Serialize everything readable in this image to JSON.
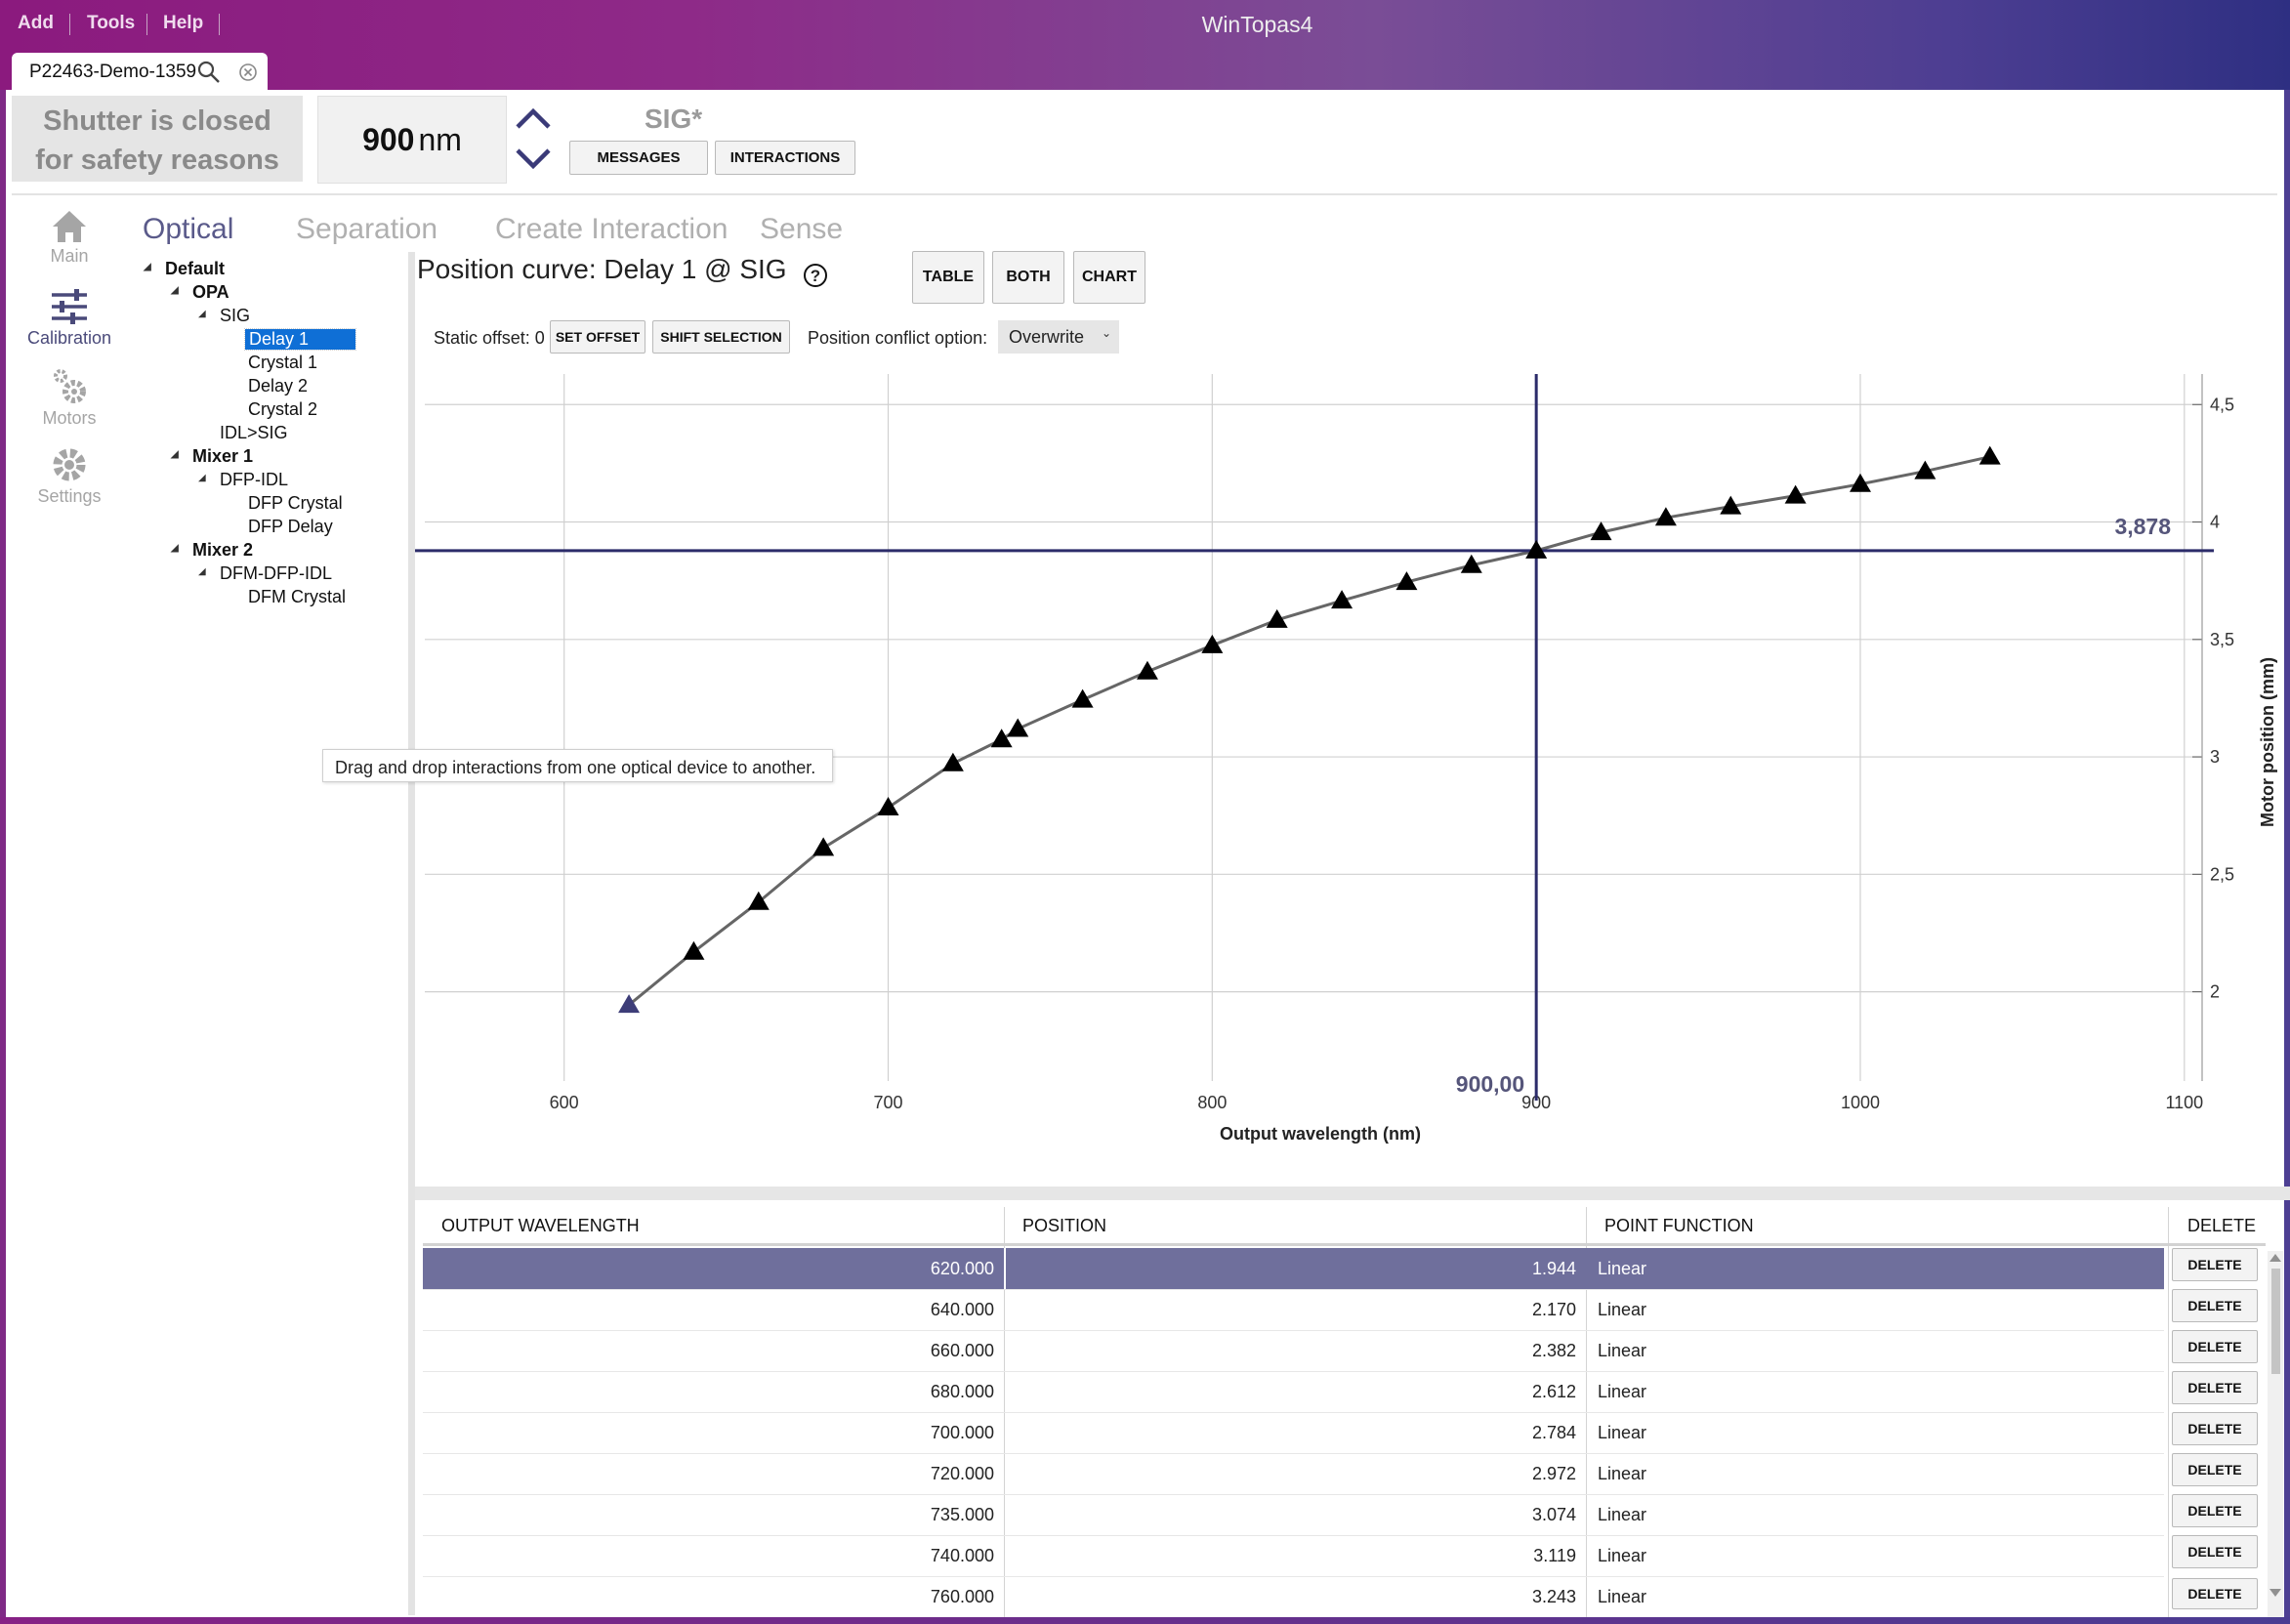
{
  "window": {
    "title": "WinTopas4",
    "menu": [
      "Add",
      "Tools",
      "Help"
    ],
    "tab_label": "P22463-Demo-1359"
  },
  "status": {
    "shutter_line1": "Shutter is closed",
    "shutter_line2": "for safety reasons",
    "wavelength_value": "900",
    "wavelength_unit": "nm",
    "device_label": "SIG*",
    "messages_button": "MESSAGES",
    "interactions_button": "INTERACTIONS"
  },
  "nav": {
    "items": [
      {
        "label": "Main",
        "icon": "home-icon"
      },
      {
        "label": "Calibration",
        "icon": "sliders-icon"
      },
      {
        "label": "Motors",
        "icon": "gears-icon"
      },
      {
        "label": "Settings",
        "icon": "gear-icon"
      }
    ]
  },
  "section_tabs": [
    "Optical",
    "Separation",
    "Create Interaction",
    "Sense"
  ],
  "tree": [
    "Default",
    "OPA",
    "SIG",
    "Delay 1",
    "Crystal 1",
    "Delay 2",
    "Crystal 2",
    "IDL>SIG",
    "Mixer 1",
    "DFP-IDL",
    "DFP Crystal",
    "DFP Delay",
    "Mixer 2",
    "DFM-DFP-IDL",
    "DFM Crystal"
  ],
  "curve": {
    "title": "Position curve: Delay 1 @ SIG",
    "help_glyph": "?",
    "view_buttons": [
      "TABLE",
      "BOTH",
      "CHART"
    ],
    "static_offset_label": "Static offset: 0",
    "set_offset_button": "SET OFFSET",
    "shift_selection_button": "SHIFT SELECTION",
    "conflict_label": "Position conflict option:",
    "conflict_value": "Overwrite"
  },
  "tooltip": "Drag and drop interactions from one optical device to another.",
  "chart_data": {
    "type": "line",
    "xlabel": "Output wavelength (nm)",
    "ylabel": "Motor position (mm)",
    "xlim": [
      557,
      1110
    ],
    "ylim": [
      1.62,
      4.63
    ],
    "xticks": [
      600,
      700,
      800,
      900,
      1000,
      1100
    ],
    "yticks": [
      2,
      2.5,
      3,
      3.5,
      4,
      4.5
    ],
    "xtick_labels": [
      "600",
      "700",
      "800",
      "900",
      "1000",
      "1100"
    ],
    "ytick_labels": [
      "2",
      "2,5",
      "3",
      "3,5",
      "4",
      "4,5"
    ],
    "grid": true,
    "cursor_x": 900,
    "cursor_y": 3.878,
    "cursor_x_label": "900,00",
    "cursor_y_label": "3,878",
    "marker_color": "#000000",
    "first_marker_color": "#3d3d78",
    "line_color": "#666666",
    "cursor_color": "#2c2c6a",
    "x": [
      620,
      640,
      660,
      680,
      700,
      720,
      735,
      740,
      760,
      780,
      800,
      820,
      840,
      860,
      880,
      900,
      920,
      940,
      960,
      980,
      1000,
      1020,
      1040
    ],
    "y": [
      1.944,
      2.17,
      2.382,
      2.612,
      2.784,
      2.972,
      3.074,
      3.119,
      3.243,
      3.363,
      3.475,
      3.583,
      3.665,
      3.744,
      3.816,
      3.878,
      3.956,
      4.018,
      4.066,
      4.112,
      4.161,
      4.216,
      4.278
    ]
  },
  "table": {
    "headers": [
      "OUTPUT WAVELENGTH",
      "POSITION",
      "POINT FUNCTION",
      "DELETE"
    ],
    "rows": [
      {
        "wl": "620.000",
        "pos": "1.944",
        "fn": "Linear",
        "del": "DELETE"
      },
      {
        "wl": "640.000",
        "pos": "2.170",
        "fn": "Linear",
        "del": "DELETE"
      },
      {
        "wl": "660.000",
        "pos": "2.382",
        "fn": "Linear",
        "del": "DELETE"
      },
      {
        "wl": "680.000",
        "pos": "2.612",
        "fn": "Linear",
        "del": "DELETE"
      },
      {
        "wl": "700.000",
        "pos": "2.784",
        "fn": "Linear",
        "del": "DELETE"
      },
      {
        "wl": "720.000",
        "pos": "2.972",
        "fn": "Linear",
        "del": "DELETE"
      },
      {
        "wl": "735.000",
        "pos": "3.074",
        "fn": "Linear",
        "del": "DELETE"
      },
      {
        "wl": "740.000",
        "pos": "3.119",
        "fn": "Linear",
        "del": "DELETE"
      },
      {
        "wl": "760.000",
        "pos": "3.243",
        "fn": "Linear",
        "del": "DELETE"
      }
    ]
  }
}
